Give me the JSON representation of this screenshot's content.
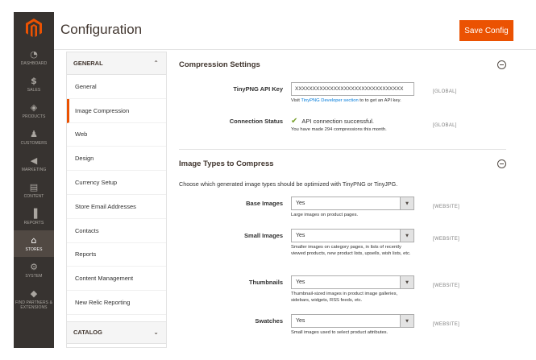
{
  "nav": {
    "items": [
      {
        "id": "dashboard",
        "label": "DASHBOARD",
        "icon": "speedometer-icon"
      },
      {
        "id": "sales",
        "label": "SALES",
        "icon": "dollar-icon"
      },
      {
        "id": "products",
        "label": "PRODUCTS",
        "icon": "cube-icon"
      },
      {
        "id": "customers",
        "label": "CUSTOMERS",
        "icon": "person-icon"
      },
      {
        "id": "marketing",
        "label": "MARKETING",
        "icon": "megaphone-icon"
      },
      {
        "id": "content",
        "label": "CONTENT",
        "icon": "layout-icon"
      },
      {
        "id": "reports",
        "label": "REPORTS",
        "icon": "bar-chart-icon"
      },
      {
        "id": "stores",
        "label": "STORES",
        "icon": "store-icon",
        "active": true
      },
      {
        "id": "system",
        "label": "SYSTEM",
        "icon": "gear-icon"
      },
      {
        "id": "partners",
        "label": "FIND PARTNERS & EXTENSIONS",
        "icon": "box-icon"
      }
    ]
  },
  "header": {
    "title": "Configuration",
    "save_label": "Save Config"
  },
  "tabs": {
    "general_label": "GENERAL",
    "general_items": [
      "General",
      "Image Compression",
      "Web",
      "Design",
      "Currency Setup",
      "Store Email Addresses",
      "Contacts",
      "Reports",
      "Content Management",
      "New Relic Reporting"
    ],
    "active": "Image Compression",
    "catalog_label": "CATALOG"
  },
  "compression": {
    "title": "Compression Settings",
    "api_key_label": "TinyPNG API Key",
    "api_key_value": "XXXXXXXXXXXXXXXXXXXXXXXXXXXXXXX",
    "api_note_prefix": "Visit ",
    "api_note_link": "TinyPNG Developer section",
    "api_note_suffix": " to to get an API key.",
    "scope": "[GLOBAL]",
    "status_label": "Connection Status",
    "status_text": "API connection successful.",
    "status_note": "You have made 294 compressions this month.",
    "status_scope": "[GLOBAL]"
  },
  "image_types": {
    "title": "Image Types to Compress",
    "intro": "Choose which generated image types should be optimized with TinyPNG or TinyJPG.",
    "rows": [
      {
        "label": "Base Images",
        "value": "Yes",
        "note": "Large images on product pages.",
        "scope": "[WEBSITE]"
      },
      {
        "label": "Small Images",
        "value": "Yes",
        "note": "Smaller images on category pages, in lists of recently viewed products, new product lists, upsells, wish lists, etc.",
        "scope": "[WEBSITE]"
      },
      {
        "label": "Thumbnails",
        "value": "Yes",
        "note": "Thumbnail-sized images in product image galleries, sidebars, widgets, RSS feeds, etc.",
        "scope": "[WEBSITE]"
      },
      {
        "label": "Swatches",
        "value": "Yes",
        "note": "Small images used to select product attributes.",
        "scope": "[WEBSITE]"
      }
    ]
  },
  "colors": {
    "accent": "#eb5202",
    "nav_bg": "#373330",
    "link": "#007bdb",
    "success": "#79a22e"
  }
}
